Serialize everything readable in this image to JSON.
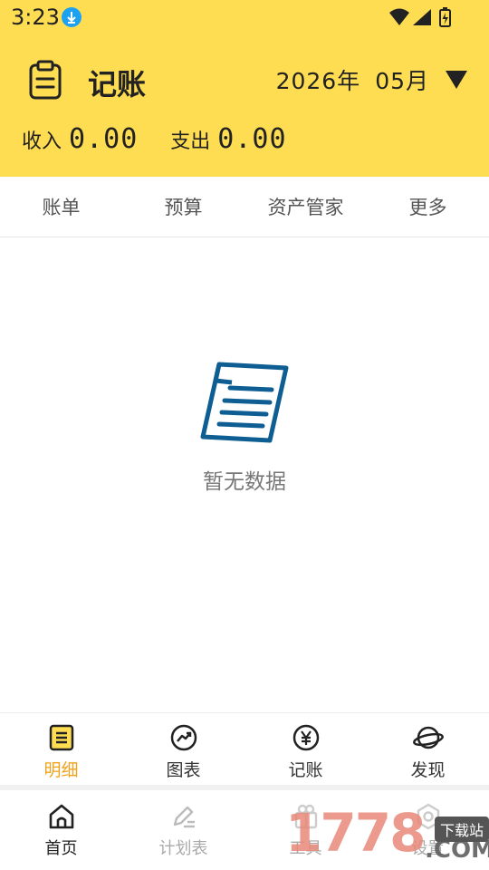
{
  "status_bar": {
    "time": "3:23"
  },
  "header": {
    "app_title": "记账",
    "year": "2026年",
    "month": "05月",
    "income_label": "收入",
    "income_value": "0.00",
    "expense_label": "支出",
    "expense_value": "0.00",
    "background_color": "#FEDD52"
  },
  "tabs": [
    {
      "label": "账单"
    },
    {
      "label": "预算"
    },
    {
      "label": "资产管家"
    },
    {
      "label": "更多"
    }
  ],
  "empty_state": {
    "message": "暂无数据",
    "icon": "document-icon"
  },
  "sub_nav": [
    {
      "label": "明细",
      "icon": "list-icon",
      "active": true
    },
    {
      "label": "图表",
      "icon": "chart-icon",
      "active": false
    },
    {
      "label": "记账",
      "icon": "yen-icon",
      "active": false
    },
    {
      "label": "发现",
      "icon": "planet-icon",
      "active": false
    }
  ],
  "bottom_nav": [
    {
      "label": "首页",
      "icon": "home-icon",
      "active": true
    },
    {
      "label": "计划表",
      "icon": "pencil-icon",
      "active": false
    },
    {
      "label": "工具",
      "icon": "gift-icon",
      "active": false
    },
    {
      "label": "设置",
      "icon": "settings-icon",
      "active": false
    }
  ],
  "watermark": {
    "number": "1778",
    "suffix": ".COM",
    "tag": "下载站"
  },
  "colors": {
    "accent": "#F0A31E",
    "icon_blue": "#0E5E93"
  }
}
